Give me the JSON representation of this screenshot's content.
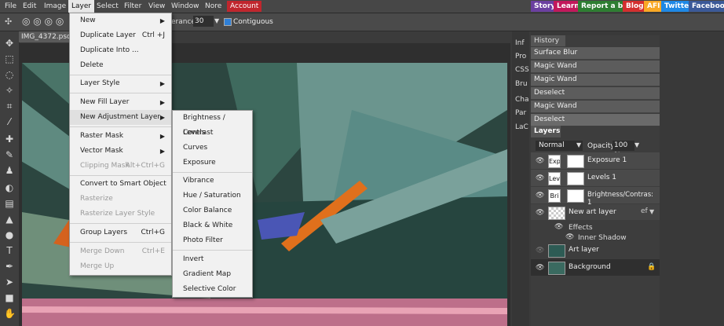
{
  "menubar": {
    "items": [
      "File",
      "Edit",
      "Image",
      "Layer",
      "Select",
      "Filter",
      "View",
      "Window",
      "Nore"
    ],
    "account": "Account",
    "right_buttons": [
      {
        "label": "Story",
        "color": "#6b3fa0"
      },
      {
        "label": "Learn",
        "color": "#c2185b"
      },
      {
        "label": "Report a bug",
        "color": "#2e7d32"
      },
      {
        "label": "Blog",
        "color": "#d32f2f"
      },
      {
        "label": "AFI",
        "color": "#f9a825"
      },
      {
        "label": "Twitter",
        "color": "#1e88e5"
      },
      {
        "label": "Facebook",
        "color": "#3b5998"
      }
    ]
  },
  "options": {
    "tolerance_label": "erance:",
    "tolerance_value": "30",
    "contiguous": "Contiguous"
  },
  "document": {
    "tab": "IMG_4372.psd *"
  },
  "sidetabs": [
    "Inf",
    "Pro",
    "CSS",
    "Bru",
    "Cha",
    "Par",
    "LaC"
  ],
  "history": {
    "title": "History",
    "items": [
      "Surface Blur",
      "Magic Wand",
      "Magic Wand",
      "Deselect",
      "Magic Wand",
      "Deselect"
    ]
  },
  "layers": {
    "title": "Layers",
    "blend": "Normal",
    "opacity_label": "Opacity:",
    "opacity_value": "100 %",
    "rows": [
      {
        "thumb": "Exp",
        "name": "Exposure 1"
      },
      {
        "thumb": "Lev",
        "name": "Levels 1"
      },
      {
        "thumb": "Bri",
        "name": "Brightness/Contras: 1"
      },
      {
        "thumb": "",
        "name": "New art layer"
      },
      {
        "thumb": "",
        "name": "Art layer"
      },
      {
        "thumb": "",
        "name": "Background"
      }
    ],
    "effects": "Effects",
    "inner_shadow": "Inner Shadow",
    "fx": "ef"
  },
  "layer_menu": [
    {
      "label": "New",
      "shortcut": "",
      "arrow": true,
      "disabled": false
    },
    {
      "label": "Duplicate Layer",
      "shortcut": "Ctrl +J",
      "arrow": false,
      "disabled": false
    },
    {
      "label": "Duplicate Into ...",
      "shortcut": "",
      "arrow": false,
      "disabled": false
    },
    {
      "label": "Delete",
      "shortcut": "",
      "arrow": false,
      "disabled": false
    },
    {
      "label": "Layer Style",
      "shortcut": "",
      "arrow": true,
      "disabled": false
    },
    {
      "label": "New Fill Layer",
      "shortcut": "",
      "arrow": true,
      "disabled": false
    },
    {
      "label": "New Adjustment Layer",
      "shortcut": "",
      "arrow": true,
      "disabled": false
    },
    {
      "label": "Raster Mask",
      "shortcut": "",
      "arrow": true,
      "disabled": false
    },
    {
      "label": "Vector Mask",
      "shortcut": "",
      "arrow": true,
      "disabled": false
    },
    {
      "label": "Clipping Mask",
      "shortcut": "Alt+Ctrl+G",
      "arrow": false,
      "disabled": true
    },
    {
      "label": "Convert to Smart Object",
      "shortcut": "",
      "arrow": false,
      "disabled": false
    },
    {
      "label": "Rasterize",
      "shortcut": "",
      "arrow": false,
      "disabled": true
    },
    {
      "label": "Rasterize Layer Style",
      "shortcut": "",
      "arrow": false,
      "disabled": true
    },
    {
      "label": "Group Layers",
      "shortcut": "Ctrl+G",
      "arrow": false,
      "disabled": false
    },
    {
      "label": "Merge Down",
      "shortcut": "Ctrl+E",
      "arrow": false,
      "disabled": true
    },
    {
      "label": "Merge Up",
      "shortcut": "",
      "arrow": false,
      "disabled": true
    }
  ],
  "adjust_menu": [
    "Brightness / Contrast",
    "Levels",
    "Curves",
    "Exposure",
    "Vibrance",
    "Hue / Saturation",
    "Color Balance",
    "Black & White",
    "Photo Filter",
    "Invert",
    "Gradient Map",
    "Selective Color"
  ]
}
